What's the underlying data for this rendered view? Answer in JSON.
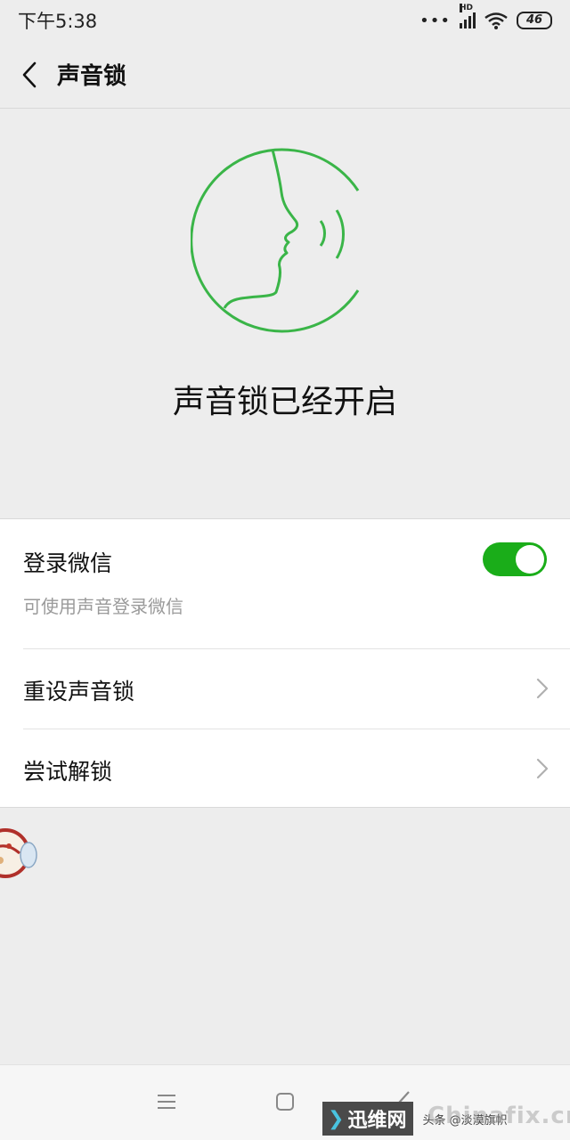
{
  "status_bar": {
    "time": "下午5:38",
    "hd": "HD",
    "battery": "46",
    "dots": "•••"
  },
  "nav": {
    "title": "声音锁"
  },
  "hero": {
    "status": "声音锁已经开启",
    "icon": "voice-face-icon",
    "accent": "#3ab548"
  },
  "login": {
    "label": "登录微信",
    "description": "可使用声音登录微信",
    "enabled": true,
    "toggle_color": "#1aad19"
  },
  "menu": [
    {
      "label": "重设声音锁"
    },
    {
      "label": "尝试解锁"
    }
  ],
  "watermark": {
    "logo": "迅维网",
    "caption": "头条 @淡漠旗帜",
    "domain": "Chinafix.cn"
  }
}
